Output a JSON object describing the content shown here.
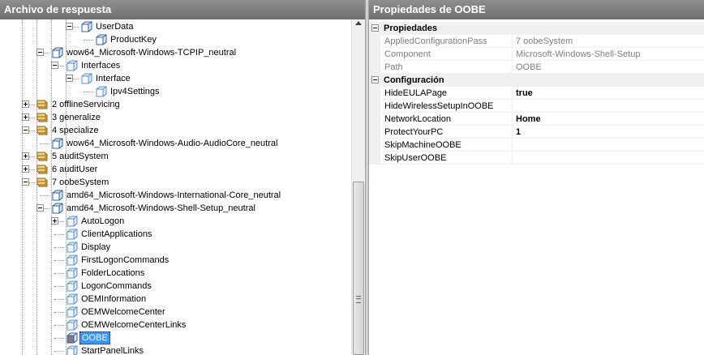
{
  "left_pane": {
    "title": "Archivo de respuesta"
  },
  "right_pane": {
    "title": "Propiedades de OOBE"
  },
  "tree": [
    {
      "label": "UserData",
      "level": 4,
      "expander": "minus",
      "icon": "component"
    },
    {
      "label": "ProductKey",
      "level": 5,
      "expander": "none",
      "icon": "component"
    },
    {
      "label": "wow64_Microsoft-Windows-TCPIP_neutral",
      "level": 2,
      "expander": "minus",
      "icon": "component"
    },
    {
      "label": "Interfaces",
      "level": 3,
      "expander": "minus",
      "icon": "setting"
    },
    {
      "label": "Interface",
      "level": 4,
      "expander": "minus",
      "icon": "setting"
    },
    {
      "label": "Ipv4Settings",
      "level": 5,
      "expander": "none",
      "icon": "setting"
    },
    {
      "label": "2 offlineServicing",
      "level": 1,
      "expander": "plus",
      "icon": "pass"
    },
    {
      "label": "3 generalize",
      "level": 1,
      "expander": "plus",
      "icon": "pass"
    },
    {
      "label": "4 specialize",
      "level": 1,
      "expander": "minus",
      "icon": "pass"
    },
    {
      "label": "wow64_Microsoft-Windows-Audio-AudioCore_neutral",
      "level": 2,
      "expander": "none",
      "icon": "component"
    },
    {
      "label": "5 auditSystem",
      "level": 1,
      "expander": "plus",
      "icon": "pass"
    },
    {
      "label": "6 auditUser",
      "level": 1,
      "expander": "plus",
      "icon": "pass"
    },
    {
      "label": "7 oobeSystem",
      "level": 1,
      "expander": "minus",
      "icon": "pass"
    },
    {
      "label": "amd64_Microsoft-Windows-International-Core_neutral",
      "level": 2,
      "expander": "none",
      "icon": "component"
    },
    {
      "label": "amd64_Microsoft-Windows-Shell-Setup_neutral",
      "level": 2,
      "expander": "minus",
      "icon": "component"
    },
    {
      "label": "AutoLogon",
      "level": 3,
      "expander": "plus",
      "icon": "setting"
    },
    {
      "label": "ClientApplications",
      "level": 3,
      "expander": "none",
      "icon": "setting"
    },
    {
      "label": "Display",
      "level": 3,
      "expander": "none",
      "icon": "setting"
    },
    {
      "label": "FirstLogonCommands",
      "level": 3,
      "expander": "none",
      "icon": "setting"
    },
    {
      "label": "FolderLocations",
      "level": 3,
      "expander": "none",
      "icon": "setting"
    },
    {
      "label": "LogonCommands",
      "level": 3,
      "expander": "none",
      "icon": "setting"
    },
    {
      "label": "OEMInformation",
      "level": 3,
      "expander": "none",
      "icon": "setting"
    },
    {
      "label": "OEMWelcomeCenter",
      "level": 3,
      "expander": "none",
      "icon": "setting"
    },
    {
      "label": "OEMWelcomeCenterLinks",
      "level": 3,
      "expander": "none",
      "icon": "setting"
    },
    {
      "label": "OOBE",
      "level": 3,
      "expander": "none",
      "icon": "setting-active",
      "selected": true
    },
    {
      "label": "StartPanelLinks",
      "level": 3,
      "expander": "none",
      "icon": "setting"
    }
  ],
  "properties": {
    "categories": [
      {
        "name": "Propiedades",
        "rows": [
          {
            "name": "AppliedConfigurationPass",
            "value": "7 oobeSystem",
            "readonly": true
          },
          {
            "name": "Component",
            "value": "Microsoft-Windows-Shell-Setup",
            "readonly": true
          },
          {
            "name": "Path",
            "value": "OOBE",
            "readonly": true
          }
        ]
      },
      {
        "name": "Configuración",
        "rows": [
          {
            "name": "HideEULAPage",
            "value": "true",
            "readonly": false
          },
          {
            "name": "HideWirelessSetupInOOBE",
            "value": "",
            "readonly": false
          },
          {
            "name": "NetworkLocation",
            "value": "Home",
            "readonly": false
          },
          {
            "name": "ProtectYourPC",
            "value": "1",
            "readonly": false
          },
          {
            "name": "SkipMachineOOBE",
            "value": "",
            "readonly": false
          },
          {
            "name": "SkipUserOOBE",
            "value": "",
            "readonly": false
          }
        ]
      }
    ]
  },
  "colors": {
    "title_bar": "#7f7f7f",
    "selection": "#3399ff",
    "category_bg": "#f0f0f0",
    "pass_icon": "#e8b448",
    "component_icon": "#5a8fd6"
  }
}
